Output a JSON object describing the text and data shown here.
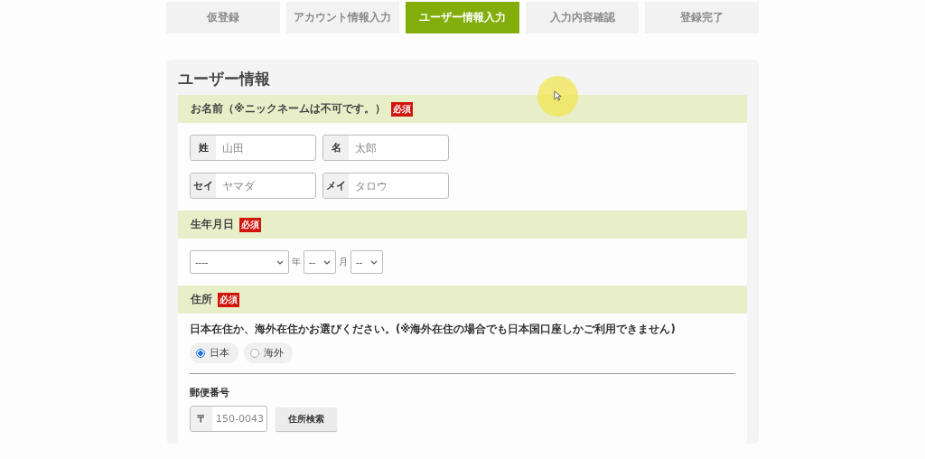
{
  "steps": [
    {
      "label": "仮登録",
      "selected": false
    },
    {
      "label": "アカウント情報入力",
      "selected": false
    },
    {
      "label": "ユーザー情報入力",
      "selected": true
    },
    {
      "label": "入力内容確認",
      "selected": false
    },
    {
      "label": "登録完了",
      "selected": false
    }
  ],
  "title": "ユーザー情報",
  "name_section": {
    "heading": "お名前（※ニックネームは不可です。）",
    "badge": "必須",
    "fields": [
      [
        {
          "label": "姓",
          "placeholder": "山田"
        },
        {
          "label": "名",
          "placeholder": "太郎"
        }
      ],
      [
        {
          "label": "セイ",
          "placeholder": "ヤマダ"
        },
        {
          "label": "メイ",
          "placeholder": "タロウ"
        }
      ]
    ]
  },
  "birth_section": {
    "heading": "生年月日",
    "badge": "必須",
    "year": "----",
    "year_unit": "年",
    "month": "--",
    "month_unit": "月",
    "day": "--"
  },
  "address_section": {
    "heading": "住所",
    "badge": "必須",
    "question": "日本在住か、海外在住かお選びください。(※海外在住の場合でも日本国口座しかご利用できません)",
    "options": [
      {
        "label": "日本",
        "selected": true
      },
      {
        "label": "海外",
        "selected": false
      }
    ],
    "postal_label": "郵便番号",
    "postal_prefix": "〒",
    "postal_placeholder": "150-0043",
    "search_button": "住所検索"
  }
}
